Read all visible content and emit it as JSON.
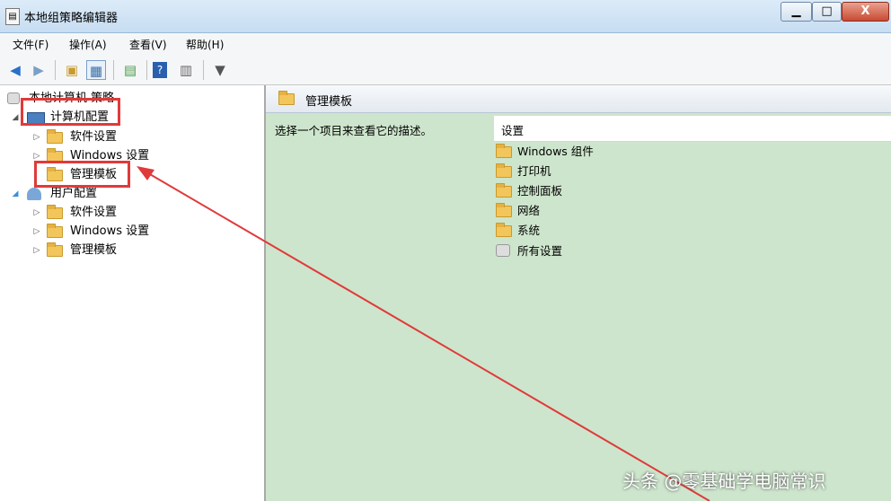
{
  "window": {
    "title": "本地组策略编辑器",
    "minimize": "▁",
    "maximize": "□",
    "close": "X"
  },
  "menu": [
    "文件(F)",
    "操作(A)",
    "查看(V)",
    "帮助(H)"
  ],
  "toolbar_icons": [
    "back-arrow-icon",
    "forward-arrow-icon",
    "up-folder-icon",
    "show-hide-tree-icon",
    "export-list-icon",
    "help-icon",
    "properties-icon",
    "filter-icon"
  ],
  "tree": {
    "root": "本地计算机 策略",
    "computer_config": "计算机配置",
    "computer_children": [
      "软件设置",
      "Windows 设置",
      "管理模板"
    ],
    "user_config": "用户配置",
    "user_children": [
      "软件设置",
      "Windows 设置",
      "管理模板"
    ]
  },
  "right_pane": {
    "header": "管理模板",
    "description": "选择一个项目来查看它的描述。",
    "list_header": "设置",
    "items": [
      "Windows 组件",
      "打印机",
      "控制面板",
      "网络",
      "系统",
      "所有设置"
    ]
  },
  "annotation_color": "#e03a3a",
  "watermark": "头条 @零基础学电脑常识"
}
